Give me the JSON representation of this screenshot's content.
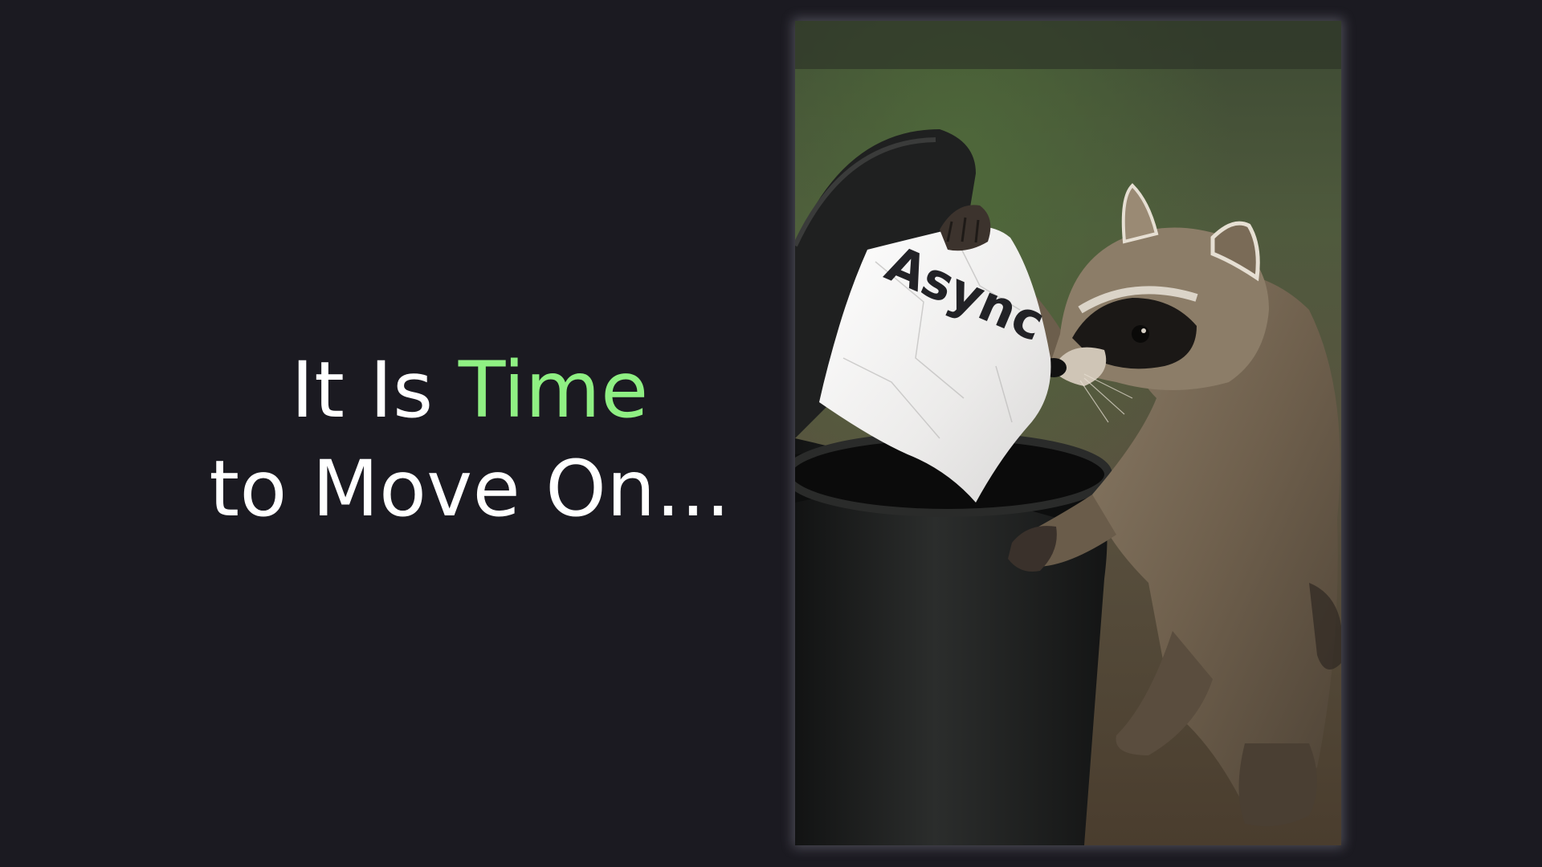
{
  "slide": {
    "headline": {
      "line1_prefix": "It Is ",
      "line1_accent": "Time",
      "line2": "to Move On..."
    },
    "photo": {
      "note_text": "Async"
    },
    "colors": {
      "background": "#1b1a21",
      "text": "#ffffff",
      "accent": "#8ff083"
    }
  }
}
